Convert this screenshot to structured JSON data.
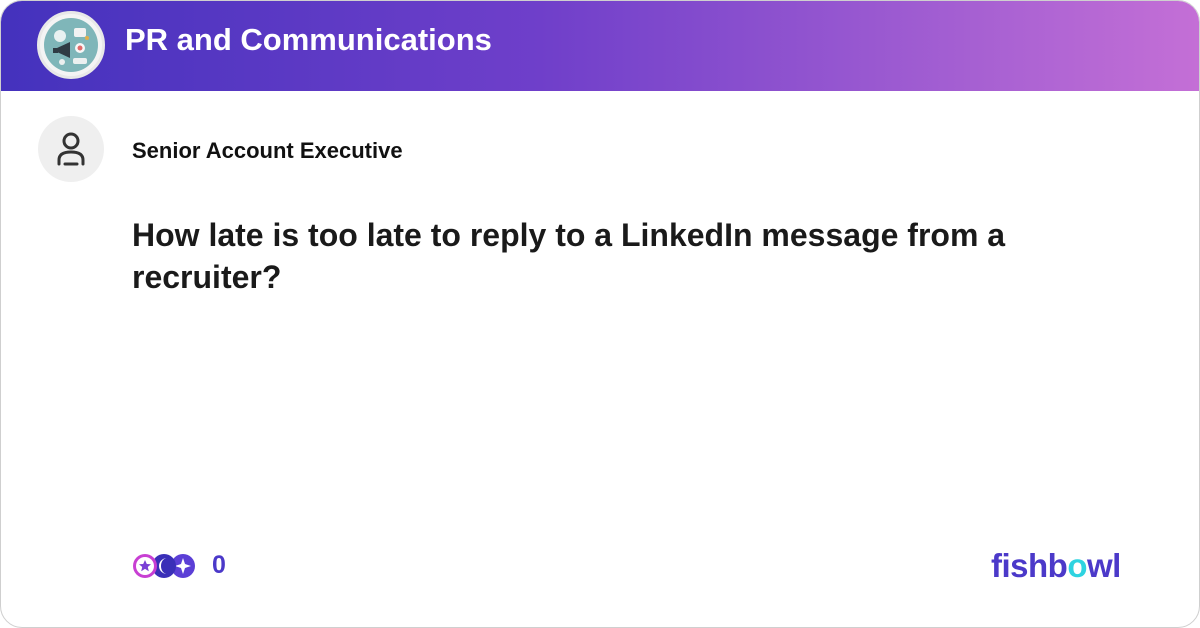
{
  "header": {
    "bowl_name": "PR and Communications",
    "bowl_logo_icon": "megaphone-collage-icon",
    "gradient_colors": [
      "#4432bd",
      "#c46fd6"
    ]
  },
  "post": {
    "author_icon": "user-icon",
    "author_title": "Senior Account Executive",
    "title": "How late is too late to reply to a LinkedIn message from a recruiter?"
  },
  "footer": {
    "reaction_icons": [
      "star-reaction-icon",
      "crescent-reaction-icon",
      "sparkle-reaction-icon"
    ],
    "reaction_count": "0",
    "brand_prefix": "fishb",
    "brand_highlight": "o",
    "brand_suffix": "wl",
    "brand_color": "#4b39c9",
    "brand_accent_color": "#2ed3e0"
  }
}
